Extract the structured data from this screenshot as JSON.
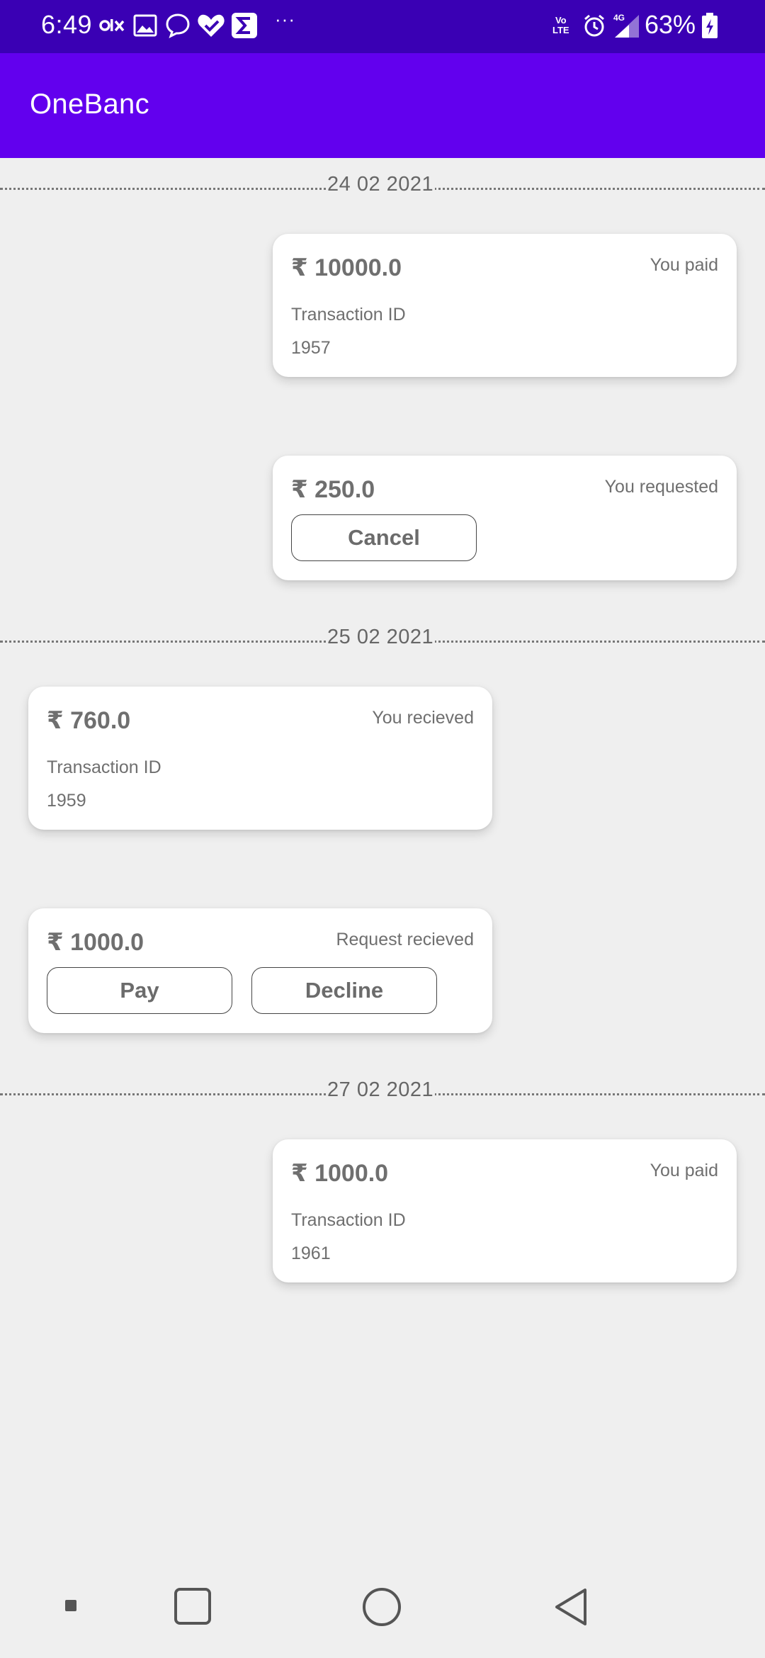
{
  "status_bar": {
    "time": "6:49",
    "more": "···",
    "network": "4G",
    "volte_top": "Vo",
    "volte_bottom": "LTE",
    "battery": "63%",
    "icons": [
      "olx-icon",
      "gallery-icon",
      "chat-bubble-icon",
      "health-heart-icon",
      "sigma-app-icon",
      "volte-icon",
      "alarm-icon",
      "signal-icon",
      "battery-charging-icon"
    ]
  },
  "app_bar": {
    "title": "OneBanc"
  },
  "sections": [
    {
      "date": "24 02 2021"
    },
    {
      "date": "25 02 2021"
    },
    {
      "date": "27 02 2021"
    }
  ],
  "transactions": [
    {
      "amount": "₹ 10000.0",
      "status": "You paid",
      "id_label": "Transaction ID",
      "id": "1957",
      "side": "right"
    },
    {
      "amount": "₹ 250.0",
      "status": "You requested",
      "button": "Cancel",
      "side": "right"
    },
    {
      "amount": "₹ 760.0",
      "status": "You recieved",
      "id_label": "Transaction ID",
      "id": "1959",
      "side": "left"
    },
    {
      "amount": "₹ 1000.0",
      "status": "Request recieved",
      "buttons": [
        "Pay",
        "Decline"
      ],
      "side": "left"
    },
    {
      "amount": "₹ 1000.0",
      "status": "You paid",
      "id_label": "Transaction ID",
      "id": "1961",
      "side": "right"
    }
  ],
  "nav_bar": {
    "icons": [
      "recents-dot-icon",
      "overview-square-icon",
      "home-circle-icon",
      "back-triangle-icon"
    ]
  },
  "colors": {
    "status_bar": "#3a00b4",
    "app_bar": "#6200ee",
    "background": "#efefef",
    "card": "#ffffff",
    "text": "#6f6f6f"
  }
}
